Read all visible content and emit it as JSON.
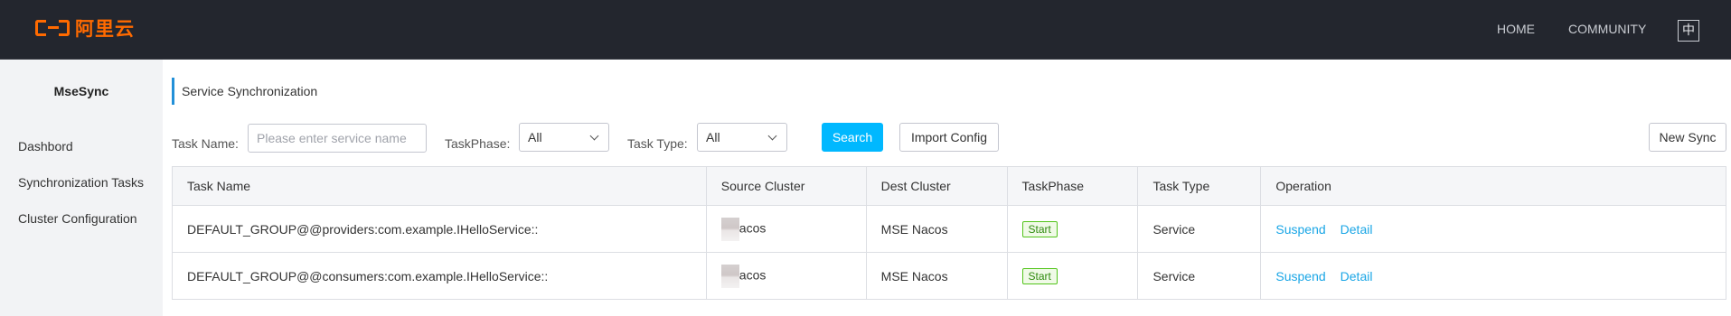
{
  "header": {
    "logo_text": "阿里云",
    "nav": {
      "home": "HOME",
      "community": "COMMUNITY"
    },
    "lang_toggle": "中"
  },
  "sidebar": {
    "title": "MseSync",
    "items": [
      {
        "label": "Dashbord"
      },
      {
        "label": "Synchronization Tasks"
      },
      {
        "label": "Cluster Configuration"
      }
    ]
  },
  "main": {
    "title": "Service Synchronization",
    "filters": {
      "task_name_label": "Task Name:",
      "task_name_placeholder": "Please enter service name",
      "task_phase_label": "TaskPhase:",
      "task_phase_value": "All",
      "task_type_label": "Task Type:",
      "task_type_value": "All"
    },
    "buttons": {
      "search": "Search",
      "import": "Import Config",
      "new_sync": "New Sync"
    },
    "table": {
      "columns": [
        "Task Name",
        "Source Cluster",
        "Dest Cluster",
        "TaskPhase",
        "Task Type",
        "Operation"
      ],
      "rows": [
        {
          "task_name": "DEFAULT_GROUP@@providers:com.example.IHelloService::",
          "source_cluster": "acos",
          "dest_cluster": "MSE Nacos",
          "phase": "Start",
          "task_type": "Service",
          "ops": [
            "Suspend",
            "Detail"
          ]
        },
        {
          "task_name": "DEFAULT_GROUP@@consumers:com.example.IHelloService::",
          "source_cluster": "acos",
          "dest_cluster": "MSE Nacos",
          "phase": "Start",
          "task_type": "Service",
          "ops": [
            "Suspend",
            "Detail"
          ]
        }
      ]
    }
  },
  "colors": {
    "header_bg": "#23262e",
    "brand": "#ff6a00",
    "primary": "#00b8ff",
    "link": "#1aa6e6",
    "badge_green": "#52c41a"
  },
  "icons": {
    "logo": "aliyun-logo-icon",
    "select_arrow": "chevron-down-icon"
  }
}
